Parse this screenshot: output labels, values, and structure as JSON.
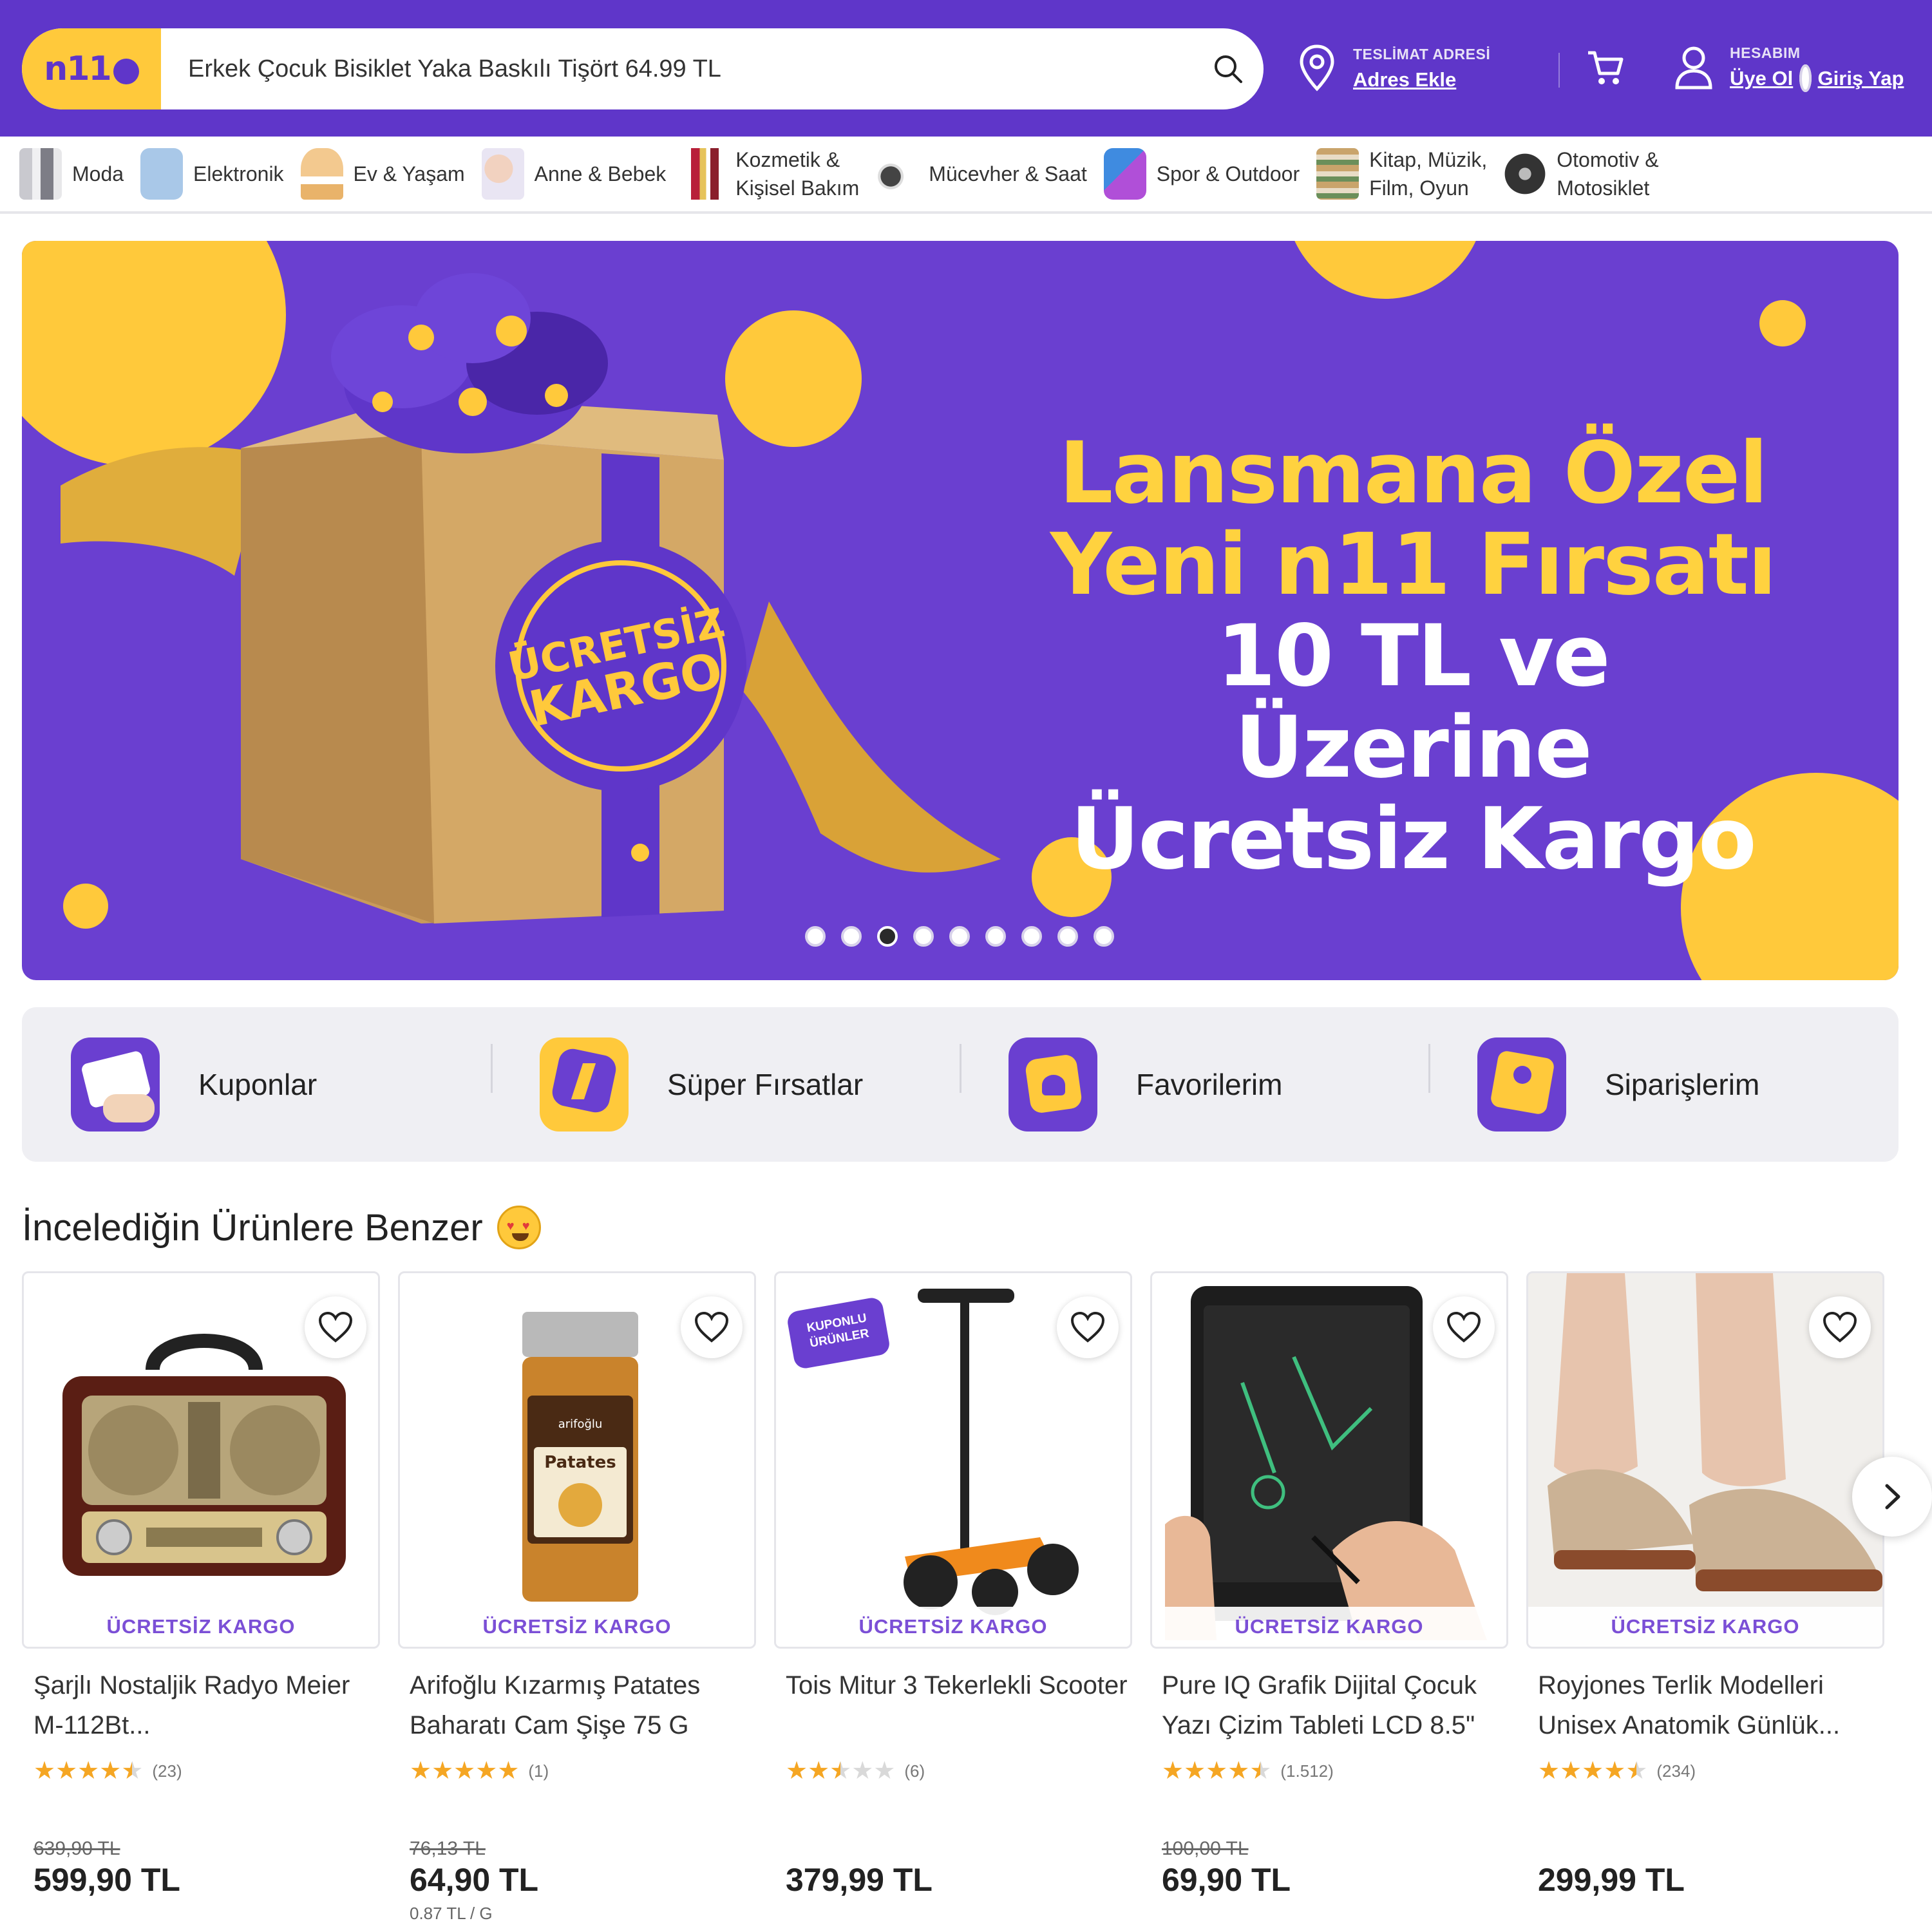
{
  "header": {
    "search_value": "Erkek Çocuk Bisiklet Yaka Baskılı Tişört 64.99 TL",
    "logo_text": "n11",
    "address_title": "TESLİMAT ADRESİ",
    "address_link": "Adres Ekle",
    "account_title": "HESABIM",
    "register_link": "Üye Ol",
    "login_link": "Giriş Yap"
  },
  "categories": [
    {
      "label": "Moda",
      "icon": "fashion-thumb"
    },
    {
      "label": "Elektronik",
      "icon": "phone-thumb"
    },
    {
      "label": "Ev & Yaşam",
      "icon": "lamp-thumb"
    },
    {
      "label": "Anne & Bebek",
      "icon": "baby-thumb"
    },
    {
      "label": "Kozmetik &\nKişisel Bakım",
      "icon": "lipstick-thumb"
    },
    {
      "label": "Mücevher & Saat",
      "icon": "jewelry-thumb"
    },
    {
      "label": "Spor & Outdoor",
      "icon": "sport-thumb"
    },
    {
      "label": "Kitap, Müzik,\nFilm, Oyun",
      "icon": "books-thumb"
    },
    {
      "label": "Otomotiv &\nMotosiklet",
      "icon": "tire-thumb"
    }
  ],
  "banner": {
    "line1": "Lansmana Özel",
    "line2": "Yeni n11 Fırsatı",
    "line3": "10 TL ve Üzerine",
    "line4": "Ücretsiz Kargo",
    "box_label_1": "ÜCRETSİZ",
    "box_label_2": "KARGO",
    "slide_count": 9,
    "active_slide": 3
  },
  "quick_links": [
    {
      "label": "Kuponlar",
      "icon": "coupon-icon"
    },
    {
      "label": "Süper Fırsatlar",
      "icon": "lightning-badge-icon"
    },
    {
      "label": "Favorilerim",
      "icon": "heart-card-icon"
    },
    {
      "label": "Siparişlerim",
      "icon": "package-icon"
    }
  ],
  "section": {
    "title": "İncelediğin Ürünlere Benzer"
  },
  "products": [
    {
      "name": "Şarjlı Nostaljik Radyo Meier M-112Bt...",
      "shipping": "ÜCRETSİZ KARGO",
      "rating": 4.5,
      "reviews": "(23)",
      "old_price": "639,90 TL",
      "price": "599,90 TL",
      "unit_price": ""
    },
    {
      "name": "Arifoğlu Kızarmış Patates Baharatı Cam Şişe 75 G",
      "shipping": "ÜCRETSİZ KARGO",
      "rating": 5,
      "reviews": "(1)",
      "old_price": "76,13 TL",
      "price": "64,90 TL",
      "unit_price": "0.87 TL / G",
      "jar_brand": "arifoğlu",
      "jar_text": "Patates"
    },
    {
      "name": "Tois Mitur 3 Tekerlekli Scooter",
      "shipping": "ÜCRETSİZ KARGO",
      "rating": 2.5,
      "reviews": "(6)",
      "old_price": "",
      "price": "379,99 TL",
      "unit_price": "",
      "badge": "KUPONLU ÜRÜNLER"
    },
    {
      "name": "Pure IQ Grafik Dijital Çocuk Yazı Çizim Tableti LCD 8.5\"",
      "shipping": "ÜCRETSİZ KARGO",
      "rating": 4.5,
      "reviews": "(1.512)",
      "old_price": "100,00 TL",
      "price": "69,90 TL",
      "unit_price": ""
    },
    {
      "name": "Royjones Terlik Modelleri Unisex Anatomik Günlük...",
      "shipping": "ÜCRETSİZ KARGO",
      "rating": 4.5,
      "reviews": "(234)",
      "old_price": "",
      "price": "299,99 TL",
      "unit_price": ""
    }
  ],
  "colors": {
    "brand_purple": "#5f36c9",
    "brand_yellow": "#ffc93b",
    "shipping_text": "#7b4fd6",
    "star": "#f5a623"
  }
}
